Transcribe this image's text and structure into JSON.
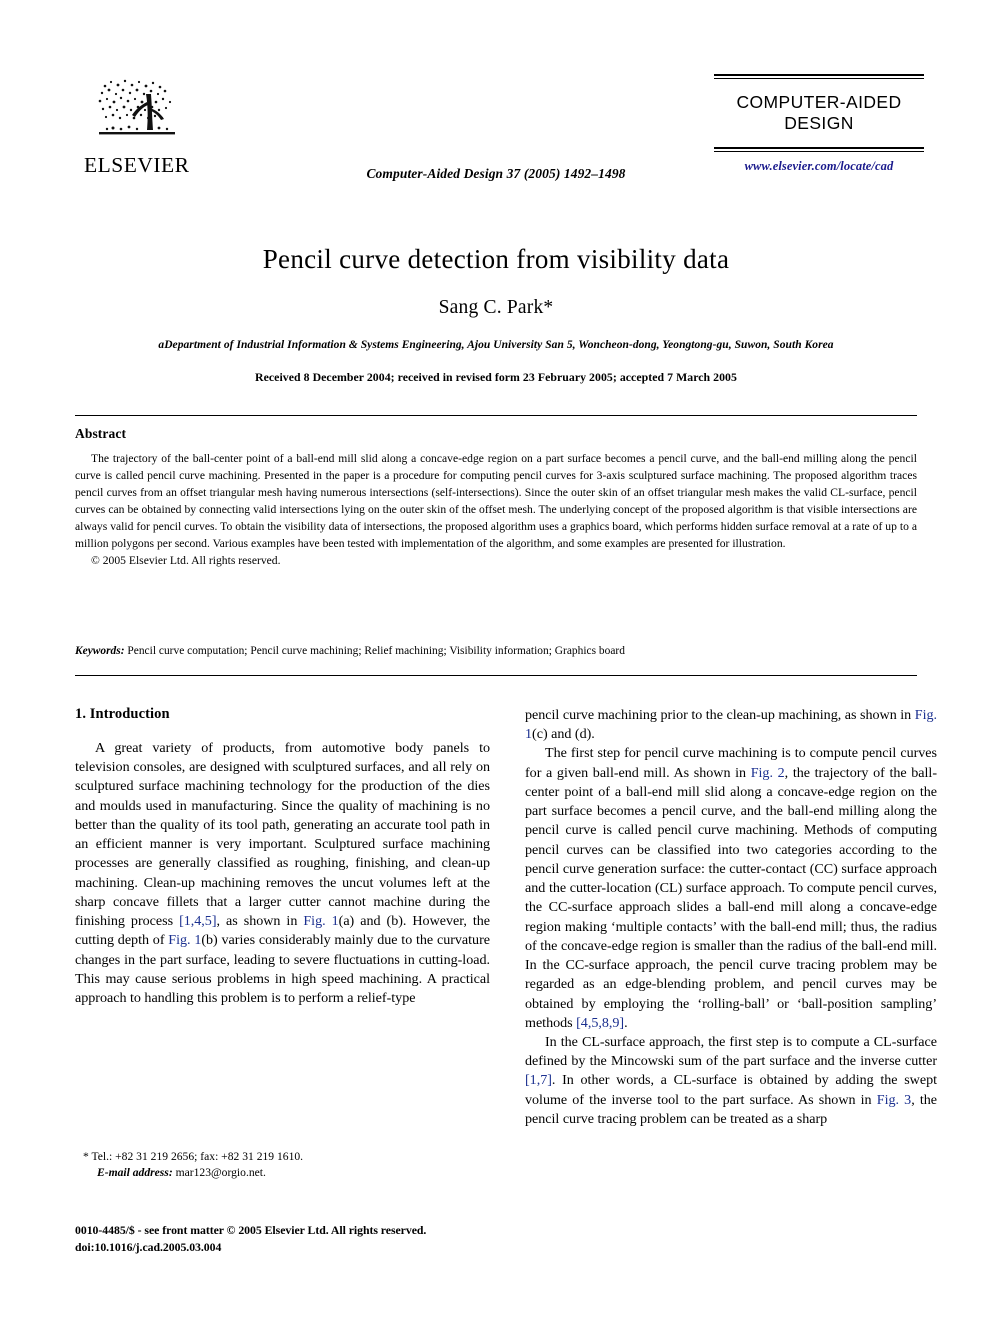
{
  "header": {
    "publisher_logo_text": "ELSEVIER",
    "logo_icon": "elsevier-tree-logo",
    "journal_citation": "Computer-Aided Design 37 (2005) 1492–1498",
    "brand_name": "COMPUTER-AIDED DESIGN",
    "brand_url": "www.elsevier.com/locate/cad"
  },
  "title_block": {
    "title": "Pencil curve detection from visibility data",
    "authors": "Sang C. Park*",
    "affiliation_marker": "a",
    "affiliation": "Department of Industrial Information & Systems Engineering, Ajou University San 5, Woncheon-dong, Yeongtong-gu, Suwon, South Korea",
    "dates": "Received 8 December 2004; received in revised form 23 February 2005; accepted 7 March 2005"
  },
  "abstract": {
    "heading": "Abstract",
    "body": "The trajectory of the ball-center point of a ball-end mill slid along a concave-edge region on a part surface becomes a pencil curve, and the ball-end milling along the pencil curve is called pencil curve machining. Presented in the paper is a procedure for computing pencil curves for 3-axis sculptured surface machining. The proposed algorithm traces pencil curves from an offset triangular mesh having numerous intersections (self-intersections). Since the outer skin of an offset triangular mesh makes the valid CL-surface, pencil curves can be obtained by connecting valid intersections lying on the outer skin of the offset mesh. The underlying concept of the proposed algorithm is that visible intersections are always valid for pencil curves. To obtain the visibility data of intersections, the proposed algorithm uses a graphics board, which performs hidden surface removal at a rate of up to a million polygons per second. Various examples have been tested with implementation of the algorithm, and some examples are presented for illustration.",
    "copyright": "© 2005 Elsevier Ltd. All rights reserved."
  },
  "keywords": {
    "label": "Keywords:",
    "text": " Pencil curve computation; Pencil curve machining; Relief machining; Visibility information; Graphics board"
  },
  "body": {
    "section_heading": "1. Introduction",
    "left_paragraph_1_a": "A great variety of products, from automotive body panels to television consoles, are designed with sculptured surfaces, and all rely on sculptured surface machining technology for the production of the dies and moulds used in manufacturing. Since the quality of machining is no better than the quality of its tool path, generating an accurate tool path in an efficient manner is very important. Sculptured surface machining processes are generally classified as roughing, finishing, and clean-up machining. Clean-up machining removes the uncut volumes left at the sharp concave fillets that a larger cutter cannot machine during the finishing process ",
    "left_ref_1": "[1,4,5]",
    "left_paragraph_1_b": ", as shown in ",
    "left_ref_fig1a": "Fig. 1",
    "left_paragraph_1_c": "(a) and (b). However, the cutting depth of ",
    "left_ref_fig1b": "Fig. 1",
    "left_paragraph_1_d": "(b) varies considerably mainly due to the curvature changes in the part surface, leading to severe fluctuations in cutting-load. This may cause serious problems in high speed machining. A practical approach to handling this problem is to perform a relief-type ",
    "right_paragraph_1_a": "pencil curve machining prior to the clean-up machining, as shown in ",
    "right_ref_fig1c": "Fig. 1",
    "right_paragraph_1_b": "(c) and (d).",
    "right_paragraph_2_a": "The first step for pencil curve machining is to compute pencil curves for a given ball-end mill. As shown in ",
    "right_ref_fig2": "Fig. 2",
    "right_paragraph_2_b": ", the trajectory of the ball-center point of a ball-end mill slid along a concave-edge region on the part surface becomes a pencil curve, and the ball-end milling along the pencil curve is called pencil curve machining. Methods of computing pencil curves can be classified into two categories according to the pencil curve generation surface: the cutter-contact (CC) surface approach and the cutter-location (CL) surface approach. To compute pencil curves, the CC-surface approach slides a ball-end mill along a concave-edge region making ‘multiple contacts’ with the ball-end mill; thus, the radius of the concave-edge region is smaller than the radius of the ball-end mill. In the CC-surface approach, the pencil curve tracing problem may be regarded as an edge-blending problem, and pencil curves may be obtained by employing the ‘rolling-ball’ or ‘ball-position sampling’ methods ",
    "right_ref_4589": "[4,5,8,9]",
    "right_paragraph_2_c": ".",
    "right_paragraph_3_a": "In the CL-surface approach, the first step is to compute a CL-surface defined by the Mincowski sum of the part surface and the inverse cutter ",
    "right_ref_17": "[1,7]",
    "right_paragraph_3_b": ". In other words, a CL-surface is obtained by adding the swept volume of the inverse tool to the part surface. As shown in ",
    "right_ref_fig3": "Fig. 3",
    "right_paragraph_3_c": ", the pencil curve tracing problem can be treated as a sharp"
  },
  "footnote": {
    "marker": "*",
    "tel_line": " Tel.: +82 31 219 2656; fax: +82 31 219 1610.",
    "email_label": "E-mail address:",
    "email_value": " mar123@orgio.net.",
    "imprint_line1": "0010-4485/$ - see front matter © 2005 Elsevier Ltd. All rights reserved.",
    "imprint_line2": "doi:10.1016/j.cad.2005.03.004"
  },
  "colors": {
    "link_blue": "#1a2f8f",
    "url_blue": "#1a1a8c"
  }
}
